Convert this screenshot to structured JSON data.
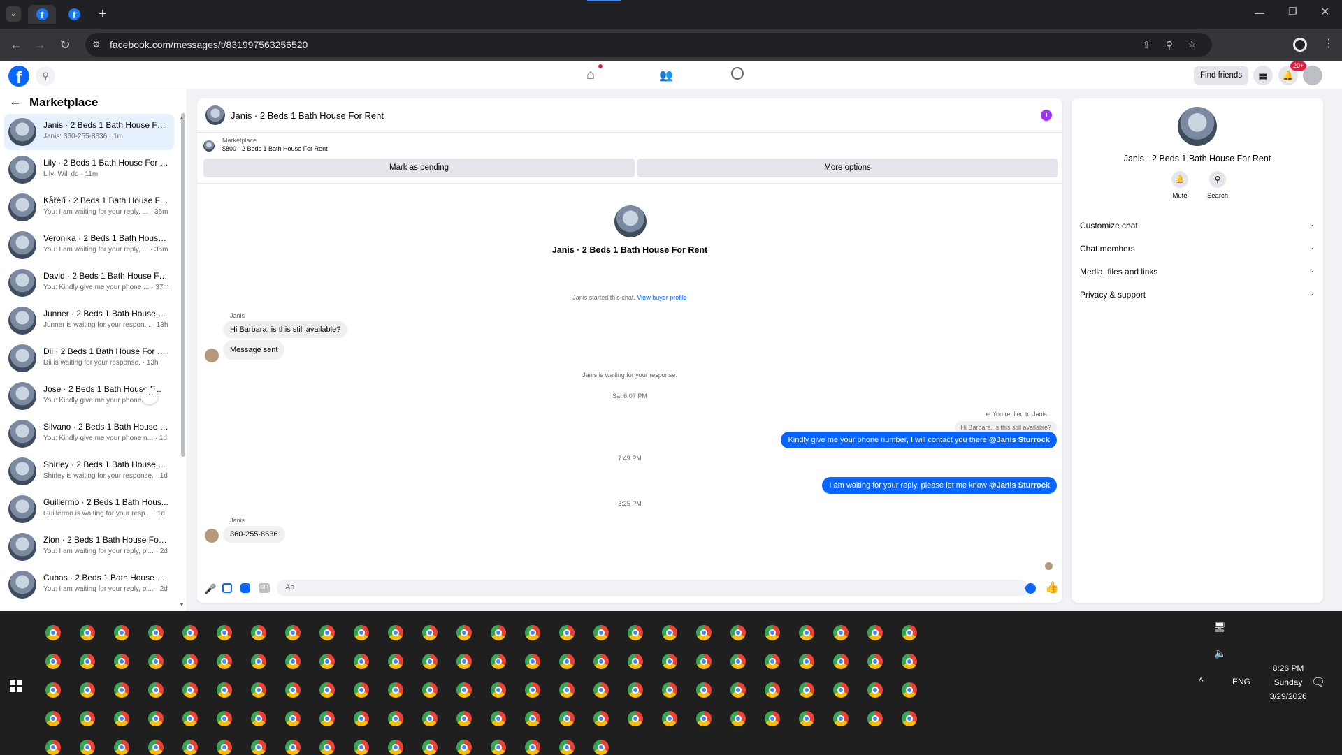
{
  "browser": {
    "url": "facebook.com/messages/t/831997563256520",
    "new_tab_label": "+"
  },
  "fb_header": {
    "find_friends": "Find friends",
    "notif_badge": "20+"
  },
  "sidebar": {
    "title": "Marketplace",
    "conversations": [
      {
        "title": "Janis · 2 Beds 1 Bath House For ...",
        "snippet": "Janis: 360-255-8636 · 1m"
      },
      {
        "title": "Lily · 2 Beds 1 Bath House For R...",
        "snippet": "Lily: Will do · 11m"
      },
      {
        "title": "Kåřêľî · 2 Beds 1 Bath House For...",
        "snippet": "You: I am waiting for your reply, ... · 35m"
      },
      {
        "title": "Veronika · 2 Beds 1 Bath House ...",
        "snippet": "You: I am waiting for your reply, ... · 35m"
      },
      {
        "title": "David · 2 Beds 1 Bath House For...",
        "snippet": "You: Kindly give me your phone ... · 37m"
      },
      {
        "title": "Junner · 2 Beds 1 Bath House F...",
        "snippet": "Junner is waiting for your respon... · 13h"
      },
      {
        "title": "Dii · 2 Beds 1 Bath House For Re...",
        "snippet": "Dii is waiting for your response. · 13h"
      },
      {
        "title": "Jose · 2 Beds 1 Bath House F...",
        "snippet": "You: Kindly give me your phone..."
      },
      {
        "title": "Silvano · 2 Beds 1 Bath House F...",
        "snippet": "You: Kindly give me your phone n... · 1d"
      },
      {
        "title": "Shirley · 2 Beds 1 Bath House F...",
        "snippet": "Shirley is waiting for your response. · 1d"
      },
      {
        "title": "Guillermo · 2 Beds 1 Bath Hous...",
        "snippet": "Guillermo is waiting for your resp... · 1d"
      },
      {
        "title": "Zion · 2 Beds 1 Bath House For ...",
        "snippet": "You: I am waiting for your reply, pl... · 2d"
      },
      {
        "title": "Cubas · 2 Beds 1 Bath House Fo...",
        "snippet": "You: I am waiting for your reply, pl... · 2d"
      }
    ],
    "more_dots": "···"
  },
  "chat": {
    "title": "Janis · 2 Beds 1 Bath House For Rent",
    "listing_source": "Marketplace",
    "listing_price_title": "$800 - 2 Beds 1 Bath House For Rent",
    "mark_pending": "Mark as pending",
    "more_options": "More options",
    "profile_name": "Janis · 2 Beds 1 Bath House For Rent",
    "started_text": "Janis started this chat.",
    "view_buyer_profile": "View buyer profile",
    "sender_name_1": "Janis",
    "msg_in_1": "Hi Barbara, is this still available?",
    "msg_in_2": "Message sent",
    "waiting_text": "Janis is waiting for your response.",
    "time_1": "Sat 6:07 PM",
    "replied_to": "You replied to Janis",
    "quoted": "Hi Barbara, is this still available?",
    "msg_out_1": "Kindly give me your phone number, I will contact you there",
    "mention": "@Janis Sturrock",
    "time_2": "7:49 PM",
    "msg_out_2": "I am waiting for your reply, please let me know",
    "time_3": "8:25 PM",
    "sender_name_2": "Janis",
    "msg_in_3": "360-255-8636",
    "composer_placeholder": "Aa"
  },
  "info_panel": {
    "name": "Janis · 2 Beds 1 Bath House For Rent",
    "mute": "Mute",
    "search": "Search",
    "rows": [
      "Customize chat",
      "Chat members",
      "Media, files and links",
      "Privacy & support"
    ]
  },
  "taskbar": {
    "lang": "ENG",
    "time": "8:26 PM",
    "day": "Sunday",
    "date": "3/29/2026"
  }
}
